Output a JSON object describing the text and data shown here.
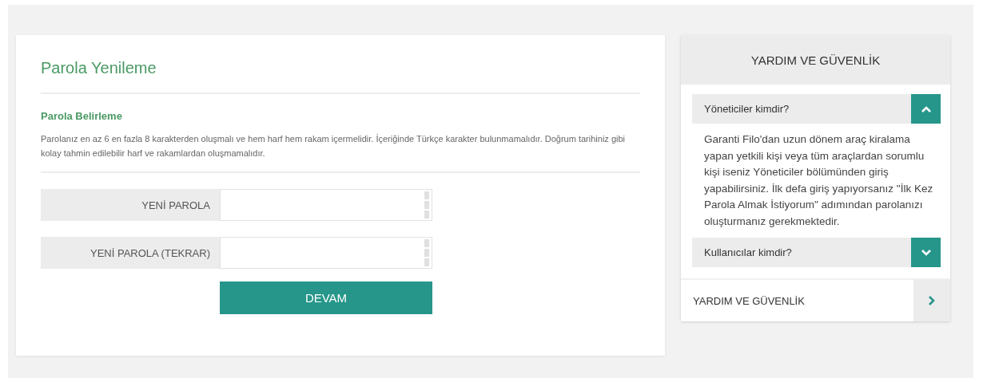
{
  "form": {
    "title": "Parola Yenileme",
    "subtitle": "Parola Belirleme",
    "description": "Parolanız en az 6 en fazla 8 karakterden oluşmalı ve hem harf hem rakam içermelidir. İçeriğinde Türkçe karakter bulunmamalıdır. Doğrum tarihiniz gibi kolay tahmin edilebilir harf ve rakamlardan oluşmamalıdır.",
    "fields": [
      {
        "label": "YENİ PAROLA"
      },
      {
        "label": "YENİ PAROLA (TEKRAR)"
      }
    ],
    "submit": "DEVAM"
  },
  "sidebar": {
    "title": "YARDIM VE GÜVENLİK",
    "faq": [
      {
        "question": "Yöneticiler kimdir?",
        "expanded": true,
        "answer": "Garanti Filo'dan uzun dönem araç kiralama yapan yetkili kişi veya tüm araçlardan sorumlu kişi iseniz Yöneticiler bölümünden giriş yapabilirsiniz. İlk defa giriş yapıyorsanız \"İlk Kez Parola Almak İstiyorum\" adımından parolanızı oluşturmanız gerekmektedir."
      },
      {
        "question": "Kullanıcılar kimdir?",
        "expanded": false
      }
    ],
    "link": "YARDIM VE GÜVENLİK"
  }
}
